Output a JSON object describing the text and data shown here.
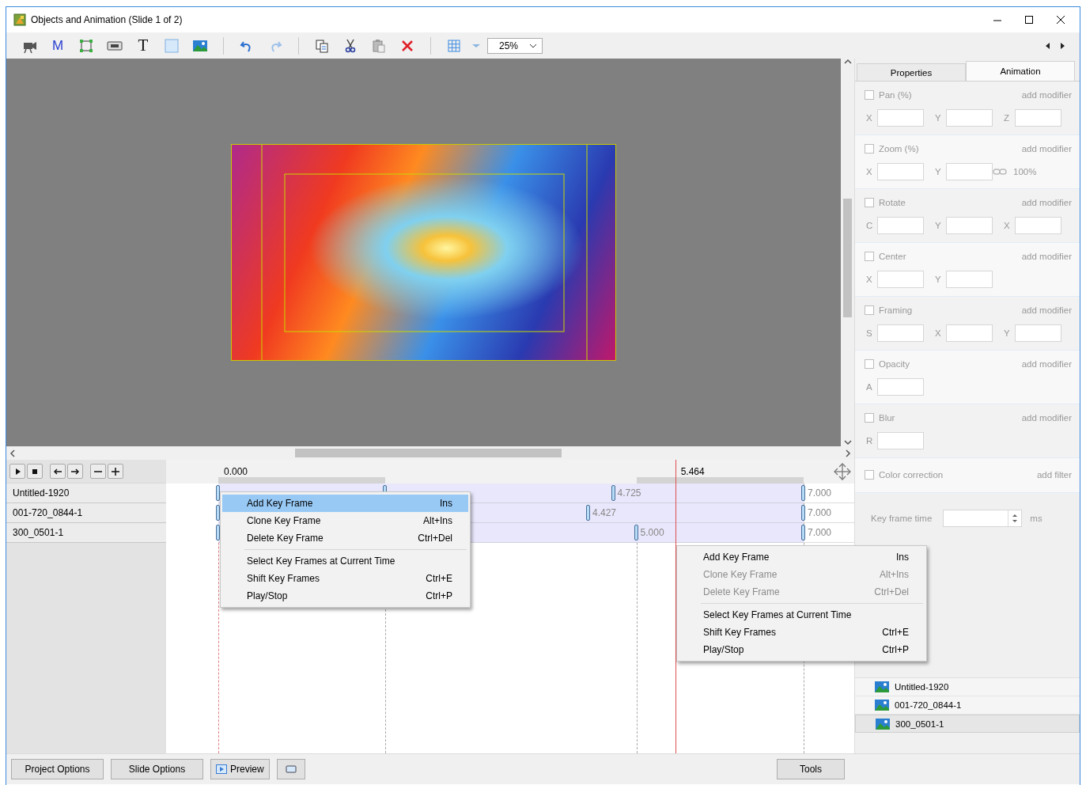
{
  "window": {
    "title": "Objects and Animation (Slide 1 of 2)"
  },
  "toolbar": {
    "text_tools": [
      {
        "text": "M"
      },
      {
        "text": "T"
      }
    ],
    "zoom": "25%"
  },
  "timeline": {
    "start": "0.000",
    "cursor": {
      "label": "5.464",
      "level": 0.7806
    },
    "tracks": [
      {
        "name": "Untitled-1920",
        "keyframes": [
          {
            "level": 0
          },
          {
            "level": 0.2857
          },
          {
            "level": 0.675,
            "label": "4.725"
          },
          {
            "level": 1,
            "label": "7.000"
          }
        ]
      },
      {
        "name": "001-720_0844-1",
        "keyframes": [
          {
            "level": 0
          },
          {
            "level": 0.6324,
            "label": "4.427"
          },
          {
            "level": 1,
            "label": "7.000"
          }
        ]
      },
      {
        "name": "300_0501-1",
        "keyframes": [
          {
            "level": 0
          },
          {
            "level": 0.7143,
            "label": "5.000"
          },
          {
            "level": 1,
            "label": "7.000"
          }
        ]
      }
    ]
  },
  "menus": [
    {
      "items": [
        {
          "kind": "item",
          "label": "Add Key Frame",
          "shortcut": "Ins",
          "selected": true,
          "disabled": false
        },
        {
          "kind": "item",
          "label": "Clone Key Frame",
          "shortcut": "Alt+Ins",
          "selected": false,
          "disabled": false
        },
        {
          "kind": "item",
          "label": "Delete Key Frame",
          "shortcut": "Ctrl+Del",
          "selected": false,
          "disabled": false
        },
        {
          "kind": "separator"
        },
        {
          "kind": "item",
          "label": "Select Key Frames at Current Time",
          "selected": false,
          "disabled": false
        },
        {
          "kind": "item",
          "label": "Shift Key Frames",
          "shortcut": "Ctrl+E",
          "selected": false,
          "disabled": false
        },
        {
          "kind": "item",
          "label": "Play/Stop",
          "shortcut": "Ctrl+P",
          "selected": false,
          "disabled": false
        }
      ]
    },
    {
      "items": [
        {
          "kind": "item",
          "label": "Add Key Frame",
          "shortcut": "Ins",
          "selected": false,
          "disabled": false
        },
        {
          "kind": "item",
          "label": "Clone Key Frame",
          "shortcut": "Alt+Ins",
          "selected": false,
          "disabled": true
        },
        {
          "kind": "item",
          "label": "Delete Key Frame",
          "shortcut": "Ctrl+Del",
          "selected": false,
          "disabled": true
        },
        {
          "kind": "separator"
        },
        {
          "kind": "item",
          "label": "Select Key Frames at Current Time",
          "selected": false,
          "disabled": false
        },
        {
          "kind": "item",
          "label": "Shift Key Frames",
          "shortcut": "Ctrl+E",
          "selected": false,
          "disabled": false
        },
        {
          "kind": "item",
          "label": "Play/Stop",
          "shortcut": "Ctrl+P",
          "selected": false,
          "disabled": false
        }
      ]
    }
  ],
  "panel": {
    "tabs": [
      {
        "label": "Properties",
        "selected": false
      },
      {
        "label": "Animation",
        "selected": true
      }
    ],
    "sections": [
      {
        "label": "Pan (%)",
        "checked": false,
        "action": "add modifier",
        "fields": [
          {
            "letter": "X"
          },
          {
            "letter": "Y"
          },
          {
            "letter": "Z"
          }
        ]
      },
      {
        "label": "Zoom (%)",
        "checked": false,
        "action": "add modifier",
        "fields": [
          {
            "letter": "X"
          },
          {
            "letter": "Y"
          }
        ],
        "link_value": "100%"
      },
      {
        "label": "Rotate",
        "checked": false,
        "action": "add modifier",
        "fields": [
          {
            "letter": "C"
          },
          {
            "letter": "Y"
          },
          {
            "letter": "X"
          }
        ]
      },
      {
        "label": "Center",
        "checked": false,
        "action": "add modifier",
        "fields": [
          {
            "letter": "X"
          },
          {
            "letter": "Y"
          }
        ]
      },
      {
        "label": "Framing",
        "checked": false,
        "action": "add modifier",
        "fields": [
          {
            "letter": "S"
          },
          {
            "letter": "X"
          },
          {
            "letter": "Y"
          }
        ]
      },
      {
        "label": "Opacity",
        "checked": false,
        "action": "add modifier",
        "fields": [
          {
            "letter": "A"
          }
        ]
      },
      {
        "label": "Blur",
        "checked": false,
        "action": "add modifier",
        "fields": [
          {
            "letter": "R"
          }
        ]
      },
      {
        "label": "Color correction",
        "checked": false,
        "action": "add filter"
      }
    ],
    "key_frame_time": {
      "label": "Key frame time",
      "unit": "ms"
    },
    "objects": [
      {
        "name": "Untitled-1920",
        "selected": false
      },
      {
        "name": "001-720_0844-1",
        "selected": false
      },
      {
        "name": "300_0501-1",
        "selected": true
      }
    ]
  },
  "bottom": {
    "left_buttons": [
      {
        "kind": "text",
        "label": "Project Options"
      },
      {
        "kind": "text",
        "label": "Slide Options"
      },
      {
        "kind": "preview",
        "label": "Preview"
      },
      {
        "kind": "icon"
      }
    ],
    "tools": "Tools"
  }
}
